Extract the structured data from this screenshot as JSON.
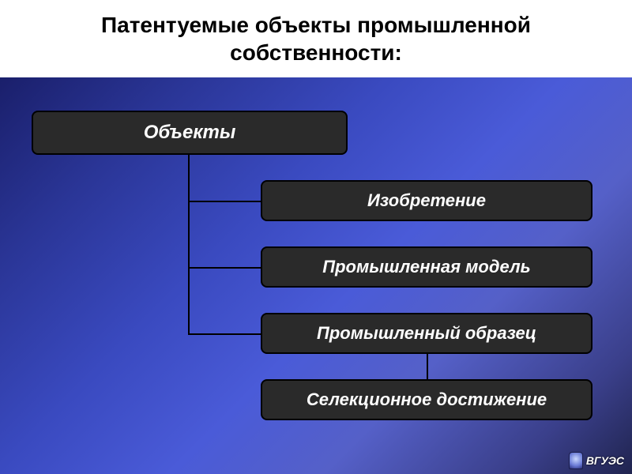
{
  "title": "Патентуемые объекты промышленной собственности:",
  "diagram": {
    "root": "Объекты",
    "children": [
      "Изобретение",
      "Промышленная модель",
      "Промышленный образец",
      "Селекционное достижение"
    ]
  },
  "logo_text": "ВГУЭС",
  "colors": {
    "node_bg": "#2a2a2a",
    "node_border": "#000000",
    "node_text": "#ffffff",
    "bg_gradient_start": "#1a1f6b",
    "bg_gradient_end": "#20244f"
  }
}
